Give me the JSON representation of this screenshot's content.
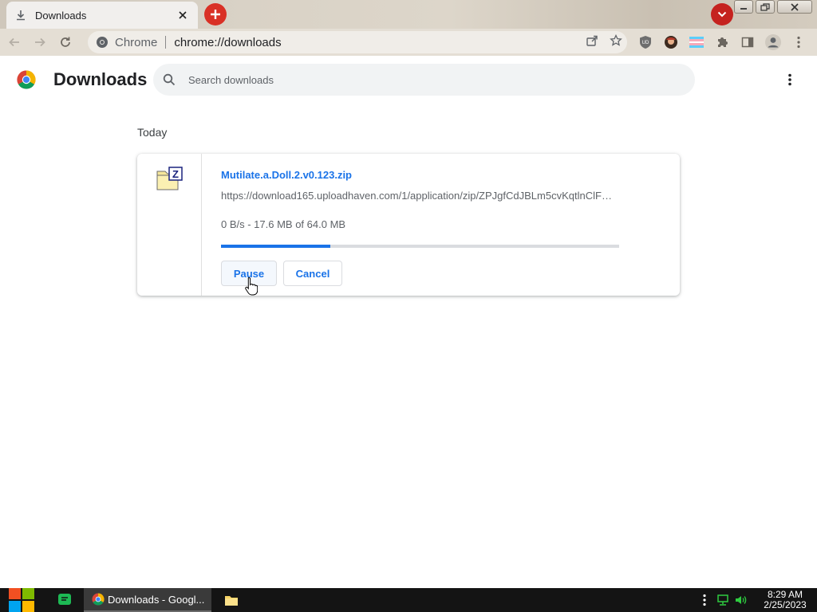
{
  "browser": {
    "tab": {
      "title": "Downloads",
      "favicon": "download-icon"
    },
    "omnibox": {
      "site_label": "Chrome",
      "url": "chrome://downloads"
    }
  },
  "page": {
    "title": "Downloads",
    "search": {
      "placeholder": "Search downloads",
      "value": ""
    },
    "sections": [
      {
        "date_label": "Today",
        "downloads": [
          {
            "file_name": "Mutilate.a.Doll.2.v0.123.zip",
            "url": "https://download165.uploadhaven.com/1/application/zip/ZPJgfCdJBLm5cvKqtlnClF…",
            "status": "0 B/s - 17.6 MB of 64.0 MB",
            "progress": 0.275,
            "buttons": {
              "pause": "Pause",
              "cancel": "Cancel"
            }
          }
        ]
      }
    ]
  },
  "taskbar": {
    "active_task": "Downloads - Googl...",
    "clock": {
      "time": "8:29 AM",
      "date": "2/25/2023"
    }
  },
  "colors": {
    "accent": "#1a73e8",
    "new_tab": "#d93025",
    "taskbar": "#141414"
  }
}
